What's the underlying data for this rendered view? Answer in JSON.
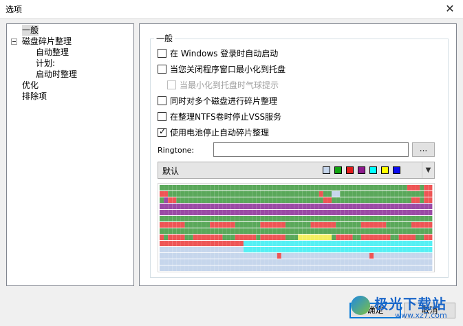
{
  "window": {
    "title": "选项",
    "close_symbol": "✕"
  },
  "tree": {
    "items": [
      {
        "label": "一般",
        "level": 1,
        "selected": true
      },
      {
        "label": "磁盘碎片整理",
        "level": 1,
        "expanded": true
      },
      {
        "label": "自动整理",
        "level": 2
      },
      {
        "label": "计划:",
        "level": 2
      },
      {
        "label": "启动时整理",
        "level": 2
      },
      {
        "label": "优化",
        "level": 1
      },
      {
        "label": "排除项",
        "level": 1
      }
    ]
  },
  "general": {
    "group_title": "一般",
    "options": [
      {
        "label": "在 Windows 登录时自动启动",
        "checked": false,
        "enabled": true
      },
      {
        "label": "当您关闭程序窗口最小化到托盘",
        "checked": false,
        "enabled": true
      },
      {
        "label": "当最小化到托盘时气球提示",
        "checked": false,
        "enabled": false
      },
      {
        "label": "同时对多个磁盘进行碎片整理",
        "checked": false,
        "enabled": true
      },
      {
        "label": "在整理NTFS卷时停止VSS服务",
        "checked": false,
        "enabled": true
      },
      {
        "label": "使用电池停止自动碎片整理",
        "checked": true,
        "enabled": true
      }
    ],
    "ringtone": {
      "label": "Ringtone:",
      "value": "",
      "browse_label": "..."
    },
    "color_scheme": {
      "selected": "默认",
      "swatches": [
        "#c6d6ec",
        "#11a311",
        "#e11a1a",
        "#8d1a8d",
        "#00ffff",
        "#ffff00",
        "#0a0aef"
      ]
    },
    "disk_map": {
      "colors": {
        "F": "#f0f0f0",
        "C": "#c6d6ec",
        "G": "#5aa85a",
        "R": "#ee5555",
        "P": "#9b4aa5",
        "Y": "#f4f060",
        "A": "#55f0f4"
      },
      "rows": [
        "GGGGGGGGGGGGGGGGGGGGGGGGGGGGGGGGGGGGGGGGGGGGGGGGGGGGGGGGGGGRRRGRR",
        "RRGGGGGGGGGGGGGGGGGGGGGGGGGGGGGGGGGGGGRGGCCGGGGGGGGGGGGGGGGGGGGRR",
        "GPRRGGGGGGGGGGGGGGGGGGGGGGGGGGGGGGGGGGGRRGGGGGGGGGGGGGGGGGGGRRGRR",
        "PPPPPPPPPPPPPPPPPPPPPPPPPPPPPPPPPPPPPPPPPPPPPPPPPPPPPPPPPPPPPPPPP",
        "PPPPPPPPPPPPPPPPPPPPPPPPPPPPPPPPPPPPPPPPPPPPPPPPPPPPPPPPPPPPPPPPP",
        "GGGGGGGGGGGGGGGGGGGGGGGGGGGGGGGGGGGGGGGGGGGGGGGGGGGGGGGGGGGGGGGGG",
        "RRRRRRGGGGGGRRRRRRGGGGGGRRRRRRGGGGGGRRRRRRGGGGGGRRRRRRGGGGGGRRRRR",
        "GGGGGGGGGGGGGGGGGGGGGGGGGGGGGGGGGGGGGGGGGGGGGGGGGGGGGGGGGGGGGGGGG",
        "RGRRRRGGRRRRRRRGGGRRRRRGRRRRRRGGGYYYYYYYYGRRRRGGRRRRRRRGGRRRRGGRR",
        "RRRRRRRRRRRRRRRRRRRRAAAAAAAAAAAAAAAAAAAAAAAAAAAAAAAAAAAAAAAAAAAAA",
        "CCCCCCCCCCCCCCCCCCCCAAAAAAAAAAAAAAAAAAAAAAAAAAAAAAAAAAAAAAAAAAAAA",
        "CCCCCCCCCCCCCCCCCCCCCCCCCCCCRCCCCCCCCCCCCCCCCCCCCCRCCCCCCCCCCCCCC",
        "CCCCCCCCCCCCCCCCCCCCCCCCCCCCCCCCCCCCCCCCCCCCCCCCCCCCCCCCCCCCCCCCC",
        "CCCCCCCCCCCCCCCCCCCCCCCCCCCCCCCCCCCCCCCCCCCCCCCCCCCCCCCCCCCCCCCCC"
      ]
    }
  },
  "footer": {
    "ok_label": "确定",
    "cancel_label": "取消"
  },
  "watermark": {
    "text": "极光下载站",
    "url": "www.xz7.com"
  }
}
